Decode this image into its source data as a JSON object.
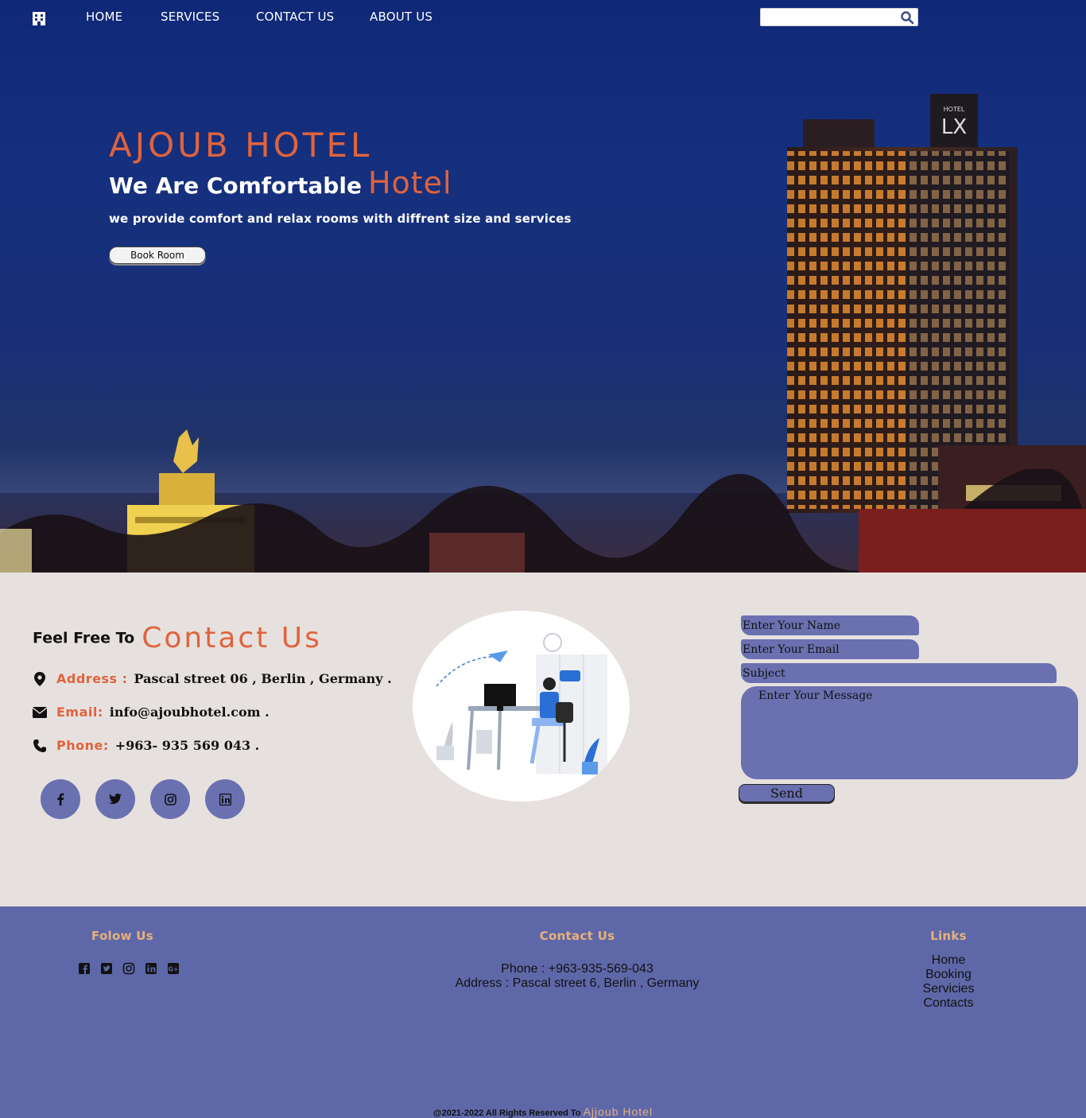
{
  "nav": {
    "items": [
      "HOME",
      "SERVICES",
      "CONTACT US",
      "ABOUT US"
    ],
    "search_placeholder": ""
  },
  "hero": {
    "title": "AJOUB HOTEL",
    "subtitle_lead": "We Are Comfortable",
    "subtitle_accent": "Hotel",
    "description": "we provide comfort and relax rooms with diffrent size and services",
    "book_button": "Book Room"
  },
  "contact": {
    "heading_lead": "Feel Free To",
    "heading_big": "Contact Us",
    "address_label": "Address :",
    "address_value": "Pascal street 06 , Berlin , Germany .",
    "email_label": "Email:",
    "email_value": "info@ajoubhotel.com .",
    "phone_label": "Phone:",
    "phone_value": "+963- 935 569 043 .",
    "social": [
      "facebook-icon",
      "twitter-icon",
      "instagram-icon",
      "linkedin-icon"
    ]
  },
  "form": {
    "name_placeholder": "Enter Your Name",
    "email_placeholder": "Enter Your Email",
    "subject_placeholder": "Subject",
    "message_placeholder": "Enter Your Message",
    "send_label": "Send"
  },
  "footer": {
    "follow_title": "Folow Us",
    "contact_title": "Contact Us",
    "contact_phone": "Phone : +963-935-569-043",
    "contact_address": "Address : Pascal street 6, Berlin , Germany",
    "links_title": "Links",
    "links": [
      "Home",
      "Booking",
      "Servicies",
      "Contacts"
    ],
    "copyright": "@2021-2022 All Rights Reserved To",
    "brand": "Ajjoub Hotel"
  },
  "colors": {
    "accent": "#e0633d",
    "form_bg": "#6a70b0",
    "footer_bg": "#5e68a8",
    "footer_title": "#e8b07a",
    "section_bg": "#e6e1de"
  }
}
